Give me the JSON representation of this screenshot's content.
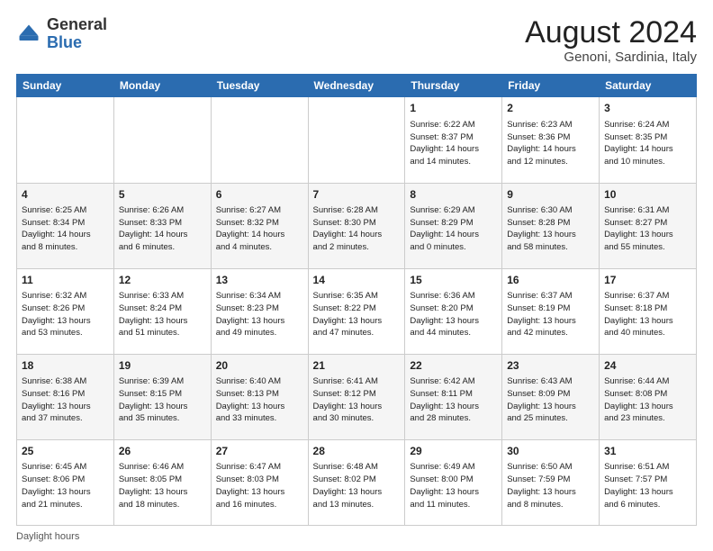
{
  "header": {
    "logo_general": "General",
    "logo_blue": "Blue",
    "month_year": "August 2024",
    "location": "Genoni, Sardinia, Italy"
  },
  "footer": {
    "label": "Daylight hours"
  },
  "weekdays": [
    "Sunday",
    "Monday",
    "Tuesday",
    "Wednesday",
    "Thursday",
    "Friday",
    "Saturday"
  ],
  "weeks": [
    [
      {
        "day": "",
        "info": ""
      },
      {
        "day": "",
        "info": ""
      },
      {
        "day": "",
        "info": ""
      },
      {
        "day": "",
        "info": ""
      },
      {
        "day": "1",
        "info": "Sunrise: 6:22 AM\nSunset: 8:37 PM\nDaylight: 14 hours\nand 14 minutes."
      },
      {
        "day": "2",
        "info": "Sunrise: 6:23 AM\nSunset: 8:36 PM\nDaylight: 14 hours\nand 12 minutes."
      },
      {
        "day": "3",
        "info": "Sunrise: 6:24 AM\nSunset: 8:35 PM\nDaylight: 14 hours\nand 10 minutes."
      }
    ],
    [
      {
        "day": "4",
        "info": "Sunrise: 6:25 AM\nSunset: 8:34 PM\nDaylight: 14 hours\nand 8 minutes."
      },
      {
        "day": "5",
        "info": "Sunrise: 6:26 AM\nSunset: 8:33 PM\nDaylight: 14 hours\nand 6 minutes."
      },
      {
        "day": "6",
        "info": "Sunrise: 6:27 AM\nSunset: 8:32 PM\nDaylight: 14 hours\nand 4 minutes."
      },
      {
        "day": "7",
        "info": "Sunrise: 6:28 AM\nSunset: 8:30 PM\nDaylight: 14 hours\nand 2 minutes."
      },
      {
        "day": "8",
        "info": "Sunrise: 6:29 AM\nSunset: 8:29 PM\nDaylight: 14 hours\nand 0 minutes."
      },
      {
        "day": "9",
        "info": "Sunrise: 6:30 AM\nSunset: 8:28 PM\nDaylight: 13 hours\nand 58 minutes."
      },
      {
        "day": "10",
        "info": "Sunrise: 6:31 AM\nSunset: 8:27 PM\nDaylight: 13 hours\nand 55 minutes."
      }
    ],
    [
      {
        "day": "11",
        "info": "Sunrise: 6:32 AM\nSunset: 8:26 PM\nDaylight: 13 hours\nand 53 minutes."
      },
      {
        "day": "12",
        "info": "Sunrise: 6:33 AM\nSunset: 8:24 PM\nDaylight: 13 hours\nand 51 minutes."
      },
      {
        "day": "13",
        "info": "Sunrise: 6:34 AM\nSunset: 8:23 PM\nDaylight: 13 hours\nand 49 minutes."
      },
      {
        "day": "14",
        "info": "Sunrise: 6:35 AM\nSunset: 8:22 PM\nDaylight: 13 hours\nand 47 minutes."
      },
      {
        "day": "15",
        "info": "Sunrise: 6:36 AM\nSunset: 8:20 PM\nDaylight: 13 hours\nand 44 minutes."
      },
      {
        "day": "16",
        "info": "Sunrise: 6:37 AM\nSunset: 8:19 PM\nDaylight: 13 hours\nand 42 minutes."
      },
      {
        "day": "17",
        "info": "Sunrise: 6:37 AM\nSunset: 8:18 PM\nDaylight: 13 hours\nand 40 minutes."
      }
    ],
    [
      {
        "day": "18",
        "info": "Sunrise: 6:38 AM\nSunset: 8:16 PM\nDaylight: 13 hours\nand 37 minutes."
      },
      {
        "day": "19",
        "info": "Sunrise: 6:39 AM\nSunset: 8:15 PM\nDaylight: 13 hours\nand 35 minutes."
      },
      {
        "day": "20",
        "info": "Sunrise: 6:40 AM\nSunset: 8:13 PM\nDaylight: 13 hours\nand 33 minutes."
      },
      {
        "day": "21",
        "info": "Sunrise: 6:41 AM\nSunset: 8:12 PM\nDaylight: 13 hours\nand 30 minutes."
      },
      {
        "day": "22",
        "info": "Sunrise: 6:42 AM\nSunset: 8:11 PM\nDaylight: 13 hours\nand 28 minutes."
      },
      {
        "day": "23",
        "info": "Sunrise: 6:43 AM\nSunset: 8:09 PM\nDaylight: 13 hours\nand 25 minutes."
      },
      {
        "day": "24",
        "info": "Sunrise: 6:44 AM\nSunset: 8:08 PM\nDaylight: 13 hours\nand 23 minutes."
      }
    ],
    [
      {
        "day": "25",
        "info": "Sunrise: 6:45 AM\nSunset: 8:06 PM\nDaylight: 13 hours\nand 21 minutes."
      },
      {
        "day": "26",
        "info": "Sunrise: 6:46 AM\nSunset: 8:05 PM\nDaylight: 13 hours\nand 18 minutes."
      },
      {
        "day": "27",
        "info": "Sunrise: 6:47 AM\nSunset: 8:03 PM\nDaylight: 13 hours\nand 16 minutes."
      },
      {
        "day": "28",
        "info": "Sunrise: 6:48 AM\nSunset: 8:02 PM\nDaylight: 13 hours\nand 13 minutes."
      },
      {
        "day": "29",
        "info": "Sunrise: 6:49 AM\nSunset: 8:00 PM\nDaylight: 13 hours\nand 11 minutes."
      },
      {
        "day": "30",
        "info": "Sunrise: 6:50 AM\nSunset: 7:59 PM\nDaylight: 13 hours\nand 8 minutes."
      },
      {
        "day": "31",
        "info": "Sunrise: 6:51 AM\nSunset: 7:57 PM\nDaylight: 13 hours\nand 6 minutes."
      }
    ]
  ]
}
